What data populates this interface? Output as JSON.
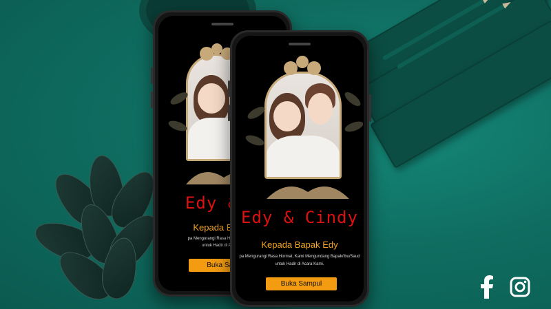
{
  "back_phone": {
    "title": "Edy & C",
    "greeting": "Kepada Bapak",
    "message_line1": "pa Mengurangi Rasa Hormat, Kami M",
    "message_line2": "untuk Hadir di Acara K",
    "button_label": "Buka Sampul"
  },
  "front_phone": {
    "title": "Edy & Cindy",
    "greeting": "Kepada Bapak Edy",
    "message_line1": "pa Mengurangi Rasa Hormat, Kami Mengundang Bapak/Ibu/Saud",
    "message_line2": "untuk Hadir di Acara Kami.",
    "button_label": "Buka Sampul"
  },
  "social": {
    "icons": [
      "facebook-icon",
      "instagram-icon"
    ]
  },
  "colors": {
    "background": "#0f6e61",
    "title_red": "#d11111",
    "accent_orange": "#f39c12",
    "frame_gold": "#c8a97a"
  }
}
